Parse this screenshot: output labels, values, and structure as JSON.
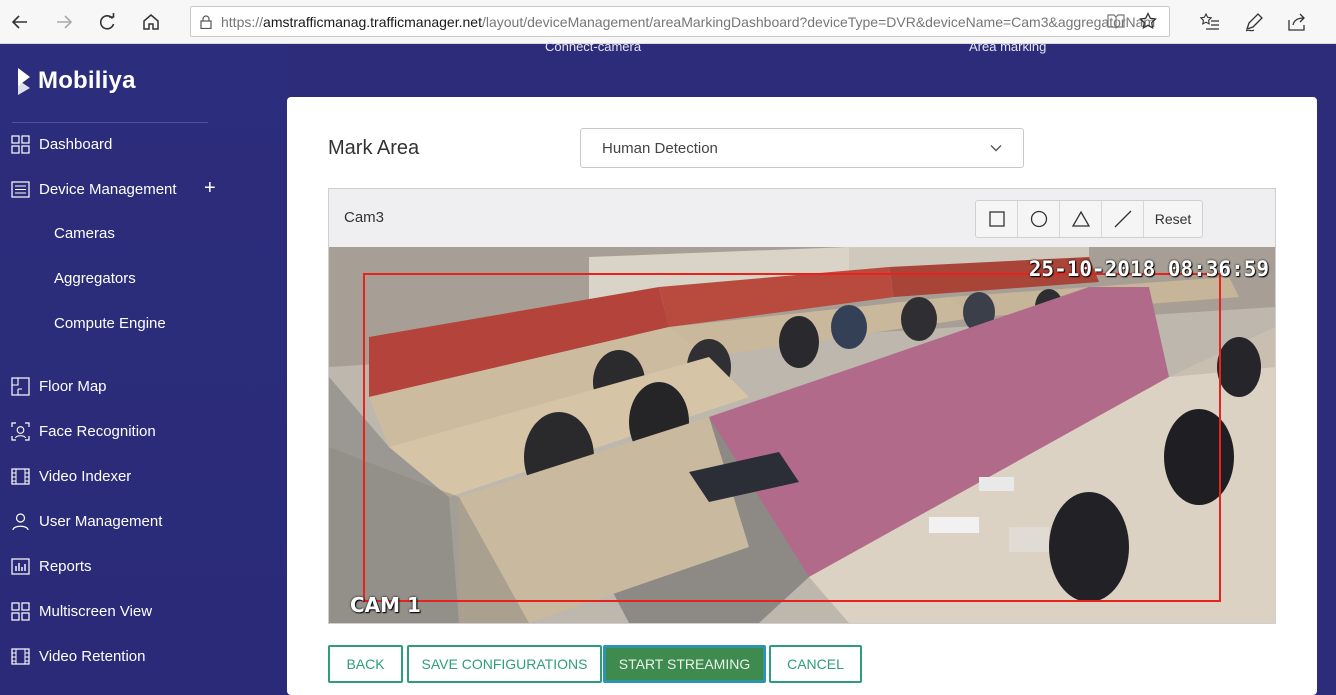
{
  "browser": {
    "url_host": "amstrafficmanag.trafficmanager.net",
    "url_scheme": "https://",
    "url_path": "/layout/deviceManagement/areaMarkingDashboard?deviceType=DVR&deviceName=Cam3&aggregatorNam"
  },
  "sidebar": {
    "brand": "Mobiliya",
    "items": [
      {
        "label": "Dashboard",
        "icon": "grid-icon"
      },
      {
        "label": "Device Management",
        "icon": "list-icon"
      },
      {
        "label": "Floor Map",
        "icon": "floor-map-icon"
      },
      {
        "label": "Face Recognition",
        "icon": "face-scan-icon"
      },
      {
        "label": "Video Indexer",
        "icon": "film-icon"
      },
      {
        "label": "User Management",
        "icon": "user-icon"
      },
      {
        "label": "Reports",
        "icon": "bar-chart-icon"
      },
      {
        "label": "Multiscreen View",
        "icon": "grid-icon"
      },
      {
        "label": "Video Retention",
        "icon": "film-icon"
      }
    ],
    "device_expand": "+",
    "sub_items": [
      {
        "label": "Cameras"
      },
      {
        "label": "Aggregators"
      },
      {
        "label": "Compute Engine"
      }
    ]
  },
  "steps": {
    "connect": "Connect-camera",
    "area": "Area marking"
  },
  "main": {
    "mark_area_label": "Mark Area",
    "detection_select": "Human Detection",
    "camera_name": "Cam3",
    "tools": {
      "shapes": [
        "rectangle-icon",
        "circle-icon",
        "triangle-icon",
        "line-icon"
      ],
      "reset": "Reset"
    },
    "video": {
      "timestamp": "25-10-2018 08:36:59",
      "overlay_name": "CAM 1"
    },
    "buttons": {
      "back": "BACK",
      "save": "SAVE CONFIGURATIONS",
      "start": "START STREAMING",
      "cancel": "CANCEL"
    }
  },
  "colors": {
    "sidebar_bg": "#2c2d7c",
    "accent_green": "#2e9e7a",
    "primary_button": "#3e8a4f",
    "mark_rect": "#e8221c"
  }
}
